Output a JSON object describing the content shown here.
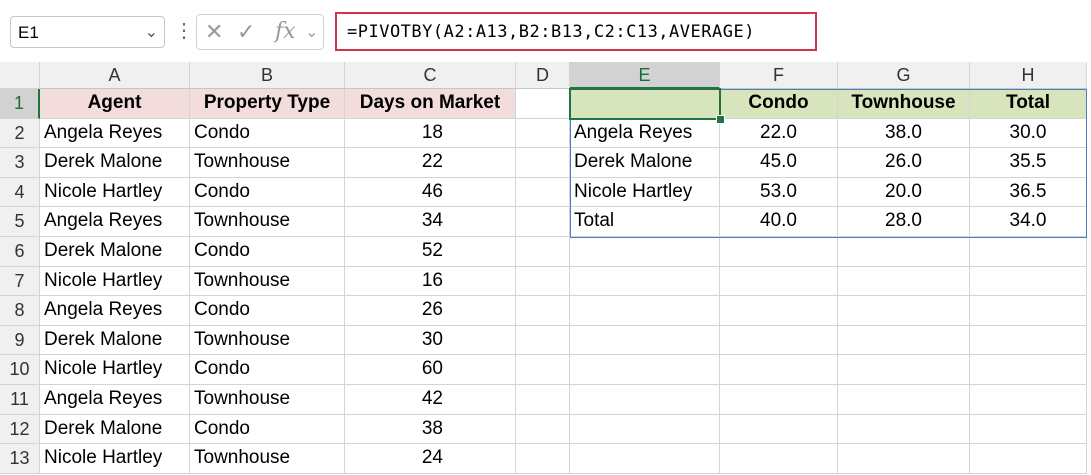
{
  "name_box": {
    "value": "E1",
    "dropdown_icon": "chevron-down-icon"
  },
  "formula_bar": {
    "cancel_icon": "✕",
    "enter_icon": "✓",
    "fx_label": "fx",
    "formula": "=PIVOTBY(A2:A13,B2:B13,C2:C13,AVERAGE)"
  },
  "columns": [
    "A",
    "B",
    "C",
    "D",
    "E",
    "F",
    "G",
    "H"
  ],
  "selected_column": "E",
  "rows": [
    "1",
    "2",
    "3",
    "4",
    "5",
    "6",
    "7",
    "8",
    "9",
    "10",
    "11",
    "12",
    "13"
  ],
  "selected_row": "1",
  "source_table": {
    "headers": [
      "Agent",
      "Property Type",
      "Days on Market"
    ],
    "rows": [
      [
        "Angela Reyes",
        "Condo",
        "18"
      ],
      [
        "Derek Malone",
        "Townhouse",
        "22"
      ],
      [
        "Nicole Hartley",
        "Condo",
        "46"
      ],
      [
        "Angela Reyes",
        "Townhouse",
        "34"
      ],
      [
        "Derek Malone",
        "Condo",
        "52"
      ],
      [
        "Nicole Hartley",
        "Townhouse",
        "16"
      ],
      [
        "Angela Reyes",
        "Condo",
        "26"
      ],
      [
        "Derek Malone",
        "Townhouse",
        "30"
      ],
      [
        "Nicole Hartley",
        "Condo",
        "60"
      ],
      [
        "Angela Reyes",
        "Townhouse",
        "42"
      ],
      [
        "Derek Malone",
        "Condo",
        "38"
      ],
      [
        "Nicole Hartley",
        "Townhouse",
        "24"
      ]
    ]
  },
  "pivot_table": {
    "headers": [
      "",
      "Condo",
      "Townhouse",
      "Total"
    ],
    "rows": [
      [
        "Angela Reyes",
        "22.0",
        "38.0",
        "30.0"
      ],
      [
        "Derek Malone",
        "45.0",
        "26.0",
        "35.5"
      ],
      [
        "Nicole Hartley",
        "53.0",
        "20.0",
        "36.5"
      ],
      [
        "Total",
        "40.0",
        "28.0",
        "34.0"
      ]
    ]
  },
  "colors": {
    "source_header_fill": "#f2dcdc",
    "pivot_header_fill": "#d8e4bc",
    "selection": "#217346",
    "formula_highlight": "#d0334d",
    "spill_border": "#4a7cc8"
  }
}
